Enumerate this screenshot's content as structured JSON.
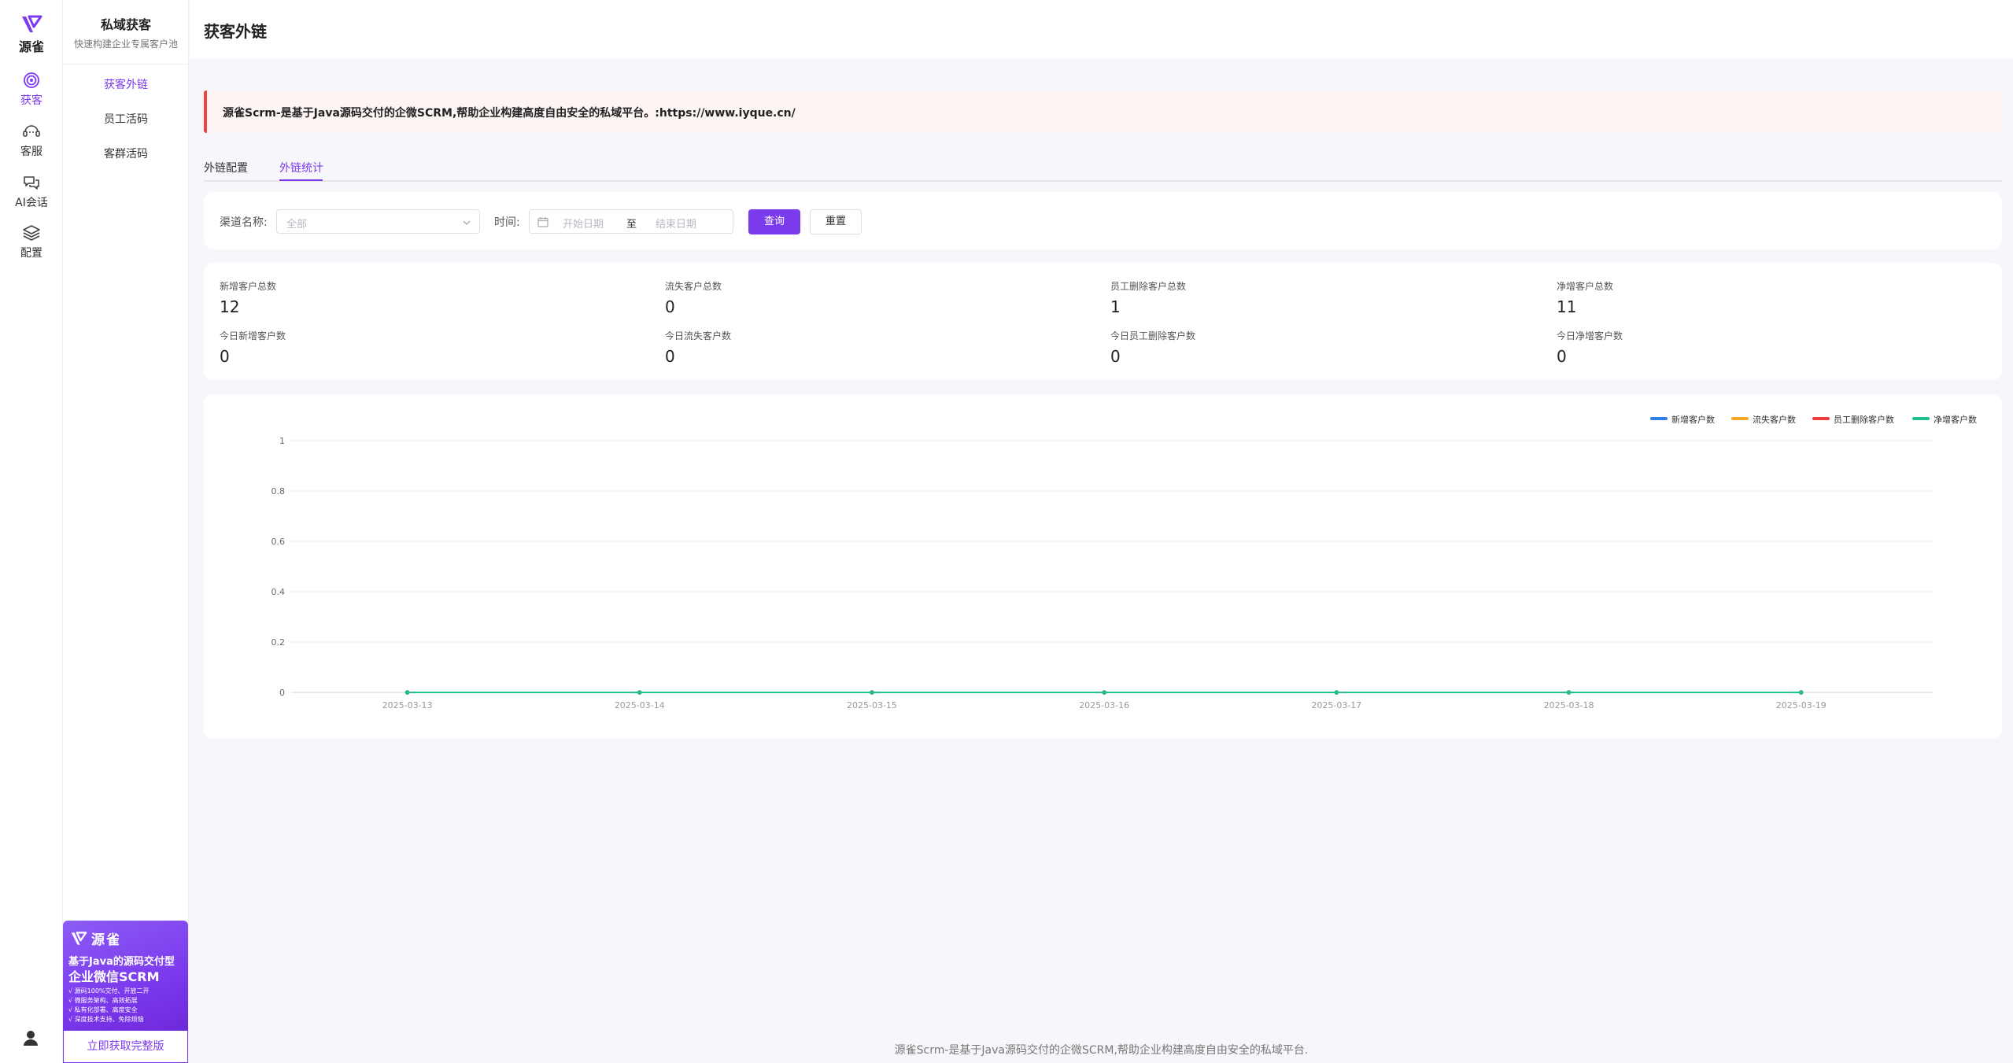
{
  "app": {
    "brand": "源雀"
  },
  "rail": {
    "items": [
      {
        "key": "huoke",
        "label": "获客",
        "icon": "target-icon",
        "active": true
      },
      {
        "key": "kefu",
        "label": "客服",
        "icon": "headset-icon",
        "active": false
      },
      {
        "key": "ai",
        "label": "AI会话",
        "icon": "chat-bubbles-icon",
        "active": false
      },
      {
        "key": "config",
        "label": "配置",
        "icon": "layers-icon",
        "active": false
      }
    ],
    "user_icon": "user-icon"
  },
  "submenu": {
    "title": "私域获客",
    "subtitle": "快速构建企业专属客户池",
    "items": [
      {
        "label": "获客外链",
        "active": true
      },
      {
        "label": "员工活码",
        "active": false
      },
      {
        "label": "客群活码",
        "active": false
      }
    ]
  },
  "promo": {
    "brand": "源雀",
    "headline1": "基于Java的源码交付型",
    "headline2": "企业微信SCRM",
    "bullets": [
      "√ 源码100%交付、开放二开",
      "√ 微服务架构、高效拓展",
      "√ 私有化部署、高度安全",
      "√ 深度技术支持、免除烦恼"
    ],
    "cta": "立即获取完整版"
  },
  "page": {
    "title": "获客外链"
  },
  "notice": {
    "text": "源雀Scrm-是基于Java源码交付的企微SCRM,帮助企业构建高度自由安全的私域平台。:https://www.iyque.cn/"
  },
  "tabs": [
    {
      "label": "外链配置",
      "active": false
    },
    {
      "label": "外链统计",
      "active": true
    }
  ],
  "filter": {
    "channel_label": "渠道名称:",
    "channel_placeholder": "全部",
    "time_label": "时间:",
    "start_placeholder": "开始日期",
    "range_separator": "至",
    "end_placeholder": "结束日期",
    "query_button": "查询",
    "reset_button": "重置"
  },
  "stats": [
    {
      "label": "新增客户总数",
      "value": "12"
    },
    {
      "label": "流失客户总数",
      "value": "0"
    },
    {
      "label": "员工删除客户总数",
      "value": "1"
    },
    {
      "label": "净增客户总数",
      "value": "11"
    },
    {
      "label": "今日新增客户数",
      "value": "0"
    },
    {
      "label": "今日流失客户数",
      "value": "0"
    },
    {
      "label": "今日员工删除客户数",
      "value": "0"
    },
    {
      "label": "今日净增客户数",
      "value": "0"
    }
  ],
  "chart_data": {
    "type": "line",
    "title": "",
    "xlabel": "",
    "ylabel": "",
    "categories": [
      "2025-03-13",
      "2025-03-14",
      "2025-03-15",
      "2025-03-16",
      "2025-03-17",
      "2025-03-18",
      "2025-03-19"
    ],
    "yticks": [
      "0",
      "0.2",
      "0.4",
      "0.6",
      "0.8",
      "1"
    ],
    "ylim": [
      0,
      1
    ],
    "grid": true,
    "legend_position": "top-right",
    "series": [
      {
        "name": "新增客户数",
        "color": "#2f7fe6",
        "values": [
          0,
          0,
          0,
          0,
          0,
          0,
          0
        ]
      },
      {
        "name": "流失客户数",
        "color": "#f5a623",
        "values": [
          0,
          0,
          0,
          0,
          0,
          0,
          0
        ]
      },
      {
        "name": "员工删除客户数",
        "color": "#ef3b3b",
        "values": [
          0,
          0,
          0,
          0,
          0,
          0,
          0
        ]
      },
      {
        "name": "净增客户数",
        "color": "#1fbf8f",
        "values": [
          0,
          0,
          0,
          0,
          0,
          0,
          0
        ]
      }
    ]
  },
  "footer": {
    "text": "源雀Scrm-是基于Java源码交付的企微SCRM,帮助企业构建高度自由安全的私域平台."
  }
}
